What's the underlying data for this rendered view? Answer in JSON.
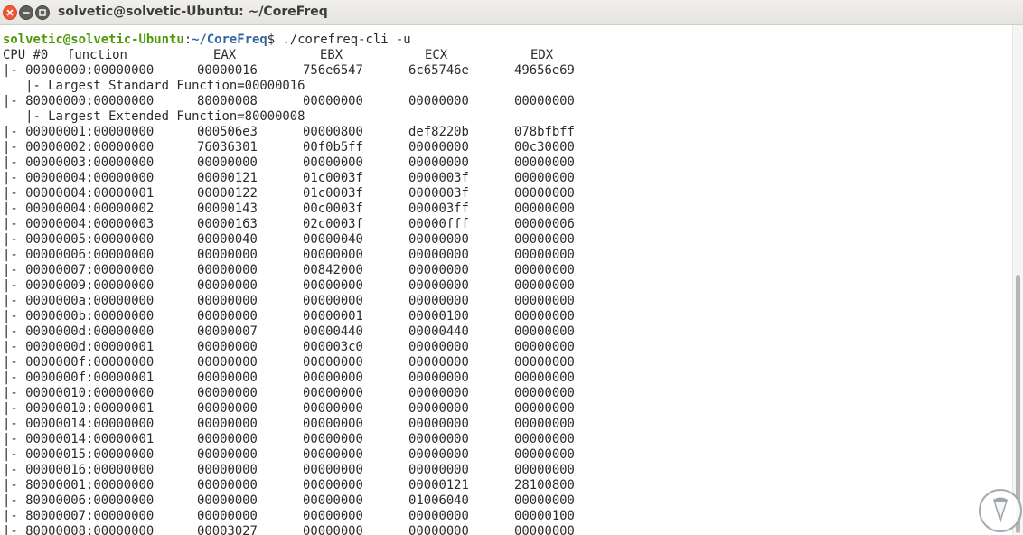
{
  "window": {
    "title": "solvetic@solvetic-Ubuntu: ~/CoreFreq"
  },
  "prompt": {
    "user_host": "solvetic@solvetic-Ubuntu",
    "colon": ":",
    "path": "~/CoreFreq",
    "symbol": "$",
    "command": " ./corefreq-cli -u"
  },
  "header": {
    "cpu_label": "CPU #0",
    "function_label": "function",
    "eax": "EAX",
    "ebx": "EBX",
    "ecx": "ECX",
    "edx": "EDX"
  },
  "rows": [
    {
      "func": "|- 00000000:00000000",
      "eax": "00000016",
      "ebx": "756e6547",
      "ecx": "6c65746e",
      "edx": "49656e69"
    },
    {
      "note": "   |- Largest Standard Function=00000016"
    },
    {
      "func": "|- 80000000:00000000",
      "eax": "80000008",
      "ebx": "00000000",
      "ecx": "00000000",
      "edx": "00000000"
    },
    {
      "note": "   |- Largest Extended Function=80000008"
    },
    {
      "func": "|- 00000001:00000000",
      "eax": "000506e3",
      "ebx": "00000800",
      "ecx": "def8220b",
      "edx": "078bfbff"
    },
    {
      "func": "|- 00000002:00000000",
      "eax": "76036301",
      "ebx": "00f0b5ff",
      "ecx": "00000000",
      "edx": "00c30000"
    },
    {
      "func": "|- 00000003:00000000",
      "eax": "00000000",
      "ebx": "00000000",
      "ecx": "00000000",
      "edx": "00000000"
    },
    {
      "func": "|- 00000004:00000000",
      "eax": "00000121",
      "ebx": "01c0003f",
      "ecx": "0000003f",
      "edx": "00000000"
    },
    {
      "func": "|- 00000004:00000001",
      "eax": "00000122",
      "ebx": "01c0003f",
      "ecx": "0000003f",
      "edx": "00000000"
    },
    {
      "func": "|- 00000004:00000002",
      "eax": "00000143",
      "ebx": "00c0003f",
      "ecx": "000003ff",
      "edx": "00000000"
    },
    {
      "func": "|- 00000004:00000003",
      "eax": "00000163",
      "ebx": "02c0003f",
      "ecx": "00000fff",
      "edx": "00000006"
    },
    {
      "func": "|- 00000005:00000000",
      "eax": "00000040",
      "ebx": "00000040",
      "ecx": "00000000",
      "edx": "00000000"
    },
    {
      "func": "|- 00000006:00000000",
      "eax": "00000000",
      "ebx": "00000000",
      "ecx": "00000000",
      "edx": "00000000"
    },
    {
      "func": "|- 00000007:00000000",
      "eax": "00000000",
      "ebx": "00842000",
      "ecx": "00000000",
      "edx": "00000000"
    },
    {
      "func": "|- 00000009:00000000",
      "eax": "00000000",
      "ebx": "00000000",
      "ecx": "00000000",
      "edx": "00000000"
    },
    {
      "func": "|- 0000000a:00000000",
      "eax": "00000000",
      "ebx": "00000000",
      "ecx": "00000000",
      "edx": "00000000"
    },
    {
      "func": "|- 0000000b:00000000",
      "eax": "00000000",
      "ebx": "00000001",
      "ecx": "00000100",
      "edx": "00000000"
    },
    {
      "func": "|- 0000000d:00000000",
      "eax": "00000007",
      "ebx": "00000440",
      "ecx": "00000440",
      "edx": "00000000"
    },
    {
      "func": "|- 0000000d:00000001",
      "eax": "00000000",
      "ebx": "000003c0",
      "ecx": "00000000",
      "edx": "00000000"
    },
    {
      "func": "|- 0000000f:00000000",
      "eax": "00000000",
      "ebx": "00000000",
      "ecx": "00000000",
      "edx": "00000000"
    },
    {
      "func": "|- 0000000f:00000001",
      "eax": "00000000",
      "ebx": "00000000",
      "ecx": "00000000",
      "edx": "00000000"
    },
    {
      "func": "|- 00000010:00000000",
      "eax": "00000000",
      "ebx": "00000000",
      "ecx": "00000000",
      "edx": "00000000"
    },
    {
      "func": "|- 00000010:00000001",
      "eax": "00000000",
      "ebx": "00000000",
      "ecx": "00000000",
      "edx": "00000000"
    },
    {
      "func": "|- 00000014:00000000",
      "eax": "00000000",
      "ebx": "00000000",
      "ecx": "00000000",
      "edx": "00000000"
    },
    {
      "func": "|- 00000014:00000001",
      "eax": "00000000",
      "ebx": "00000000",
      "ecx": "00000000",
      "edx": "00000000"
    },
    {
      "func": "|- 00000015:00000000",
      "eax": "00000000",
      "ebx": "00000000",
      "ecx": "00000000",
      "edx": "00000000"
    },
    {
      "func": "|- 00000016:00000000",
      "eax": "00000000",
      "ebx": "00000000",
      "ecx": "00000000",
      "edx": "00000000"
    },
    {
      "func": "|- 80000001:00000000",
      "eax": "00000000",
      "ebx": "00000000",
      "ecx": "00000121",
      "edx": "28100800"
    },
    {
      "func": "|- 80000006:00000000",
      "eax": "00000000",
      "ebx": "00000000",
      "ecx": "01006040",
      "edx": "00000000"
    },
    {
      "func": "|- 80000007:00000000",
      "eax": "00000000",
      "ebx": "00000000",
      "ecx": "00000000",
      "edx": "00000100"
    },
    {
      "func": "|- 80000008:00000000",
      "eax": "00003027",
      "ebx": "00000000",
      "ecx": "00000000",
      "edx": "00000000"
    }
  ],
  "colors": {
    "prompt_user": "#4e9a06",
    "prompt_path": "#3465a4",
    "text": "#2b2b2b",
    "close_button": "#ee5a36"
  },
  "icons": {
    "close": "close-icon",
    "minimize": "minimize-icon",
    "maximize": "maximize-icon",
    "watermark": "solvetic-logo-icon"
  }
}
